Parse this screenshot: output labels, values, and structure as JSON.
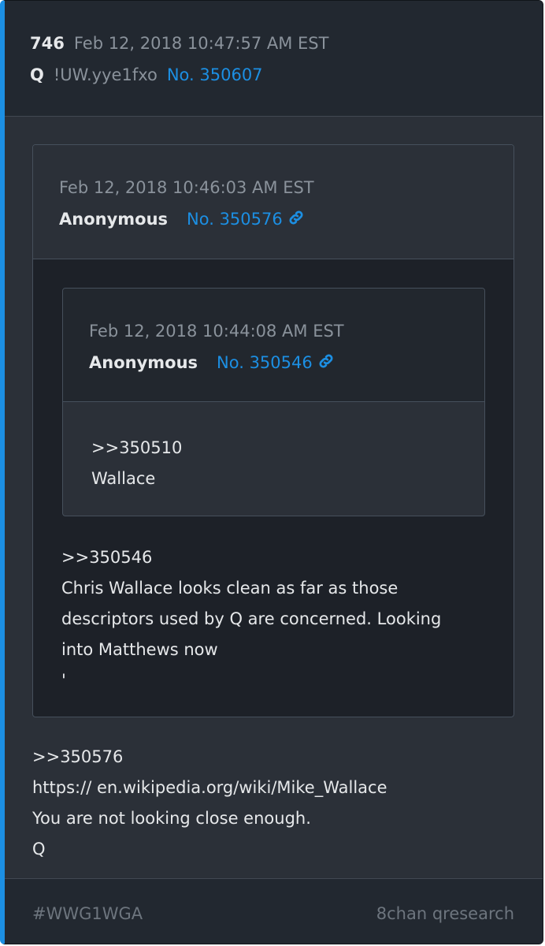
{
  "post": {
    "number": "746",
    "date": "Feb 12, 2018 10:47:57 AM EST",
    "author": "Q",
    "tripcode": "!UW.yye1fxo",
    "post_no": "No. 350607",
    "body_lines": [
      ">>350576",
      "https:// en.wikipedia.org/wiki/Mike_Wallace",
      "You are not looking close enough.",
      "Q"
    ]
  },
  "quote_outer": {
    "date": "Feb 12, 2018 10:46:03 AM EST",
    "author": "Anonymous",
    "post_no": "No. 350576",
    "body_lines": [
      ">>350546",
      "Chris Wallace looks clean as far as those",
      "descriptors used by Q are concerned. Looking",
      "into Matthews now",
      "'"
    ]
  },
  "quote_inner": {
    "date": "Feb 12, 2018 10:44:08 AM EST",
    "author": "Anonymous",
    "post_no": "No. 350546",
    "body_lines": [
      ">>350510",
      "Wallace"
    ]
  },
  "footer": {
    "hashtag": "#WWG1WGA",
    "source": "8chan qresearch"
  },
  "colors": {
    "accent": "#1c8fe3",
    "background": "#2b3038",
    "header_background": "#222830"
  }
}
